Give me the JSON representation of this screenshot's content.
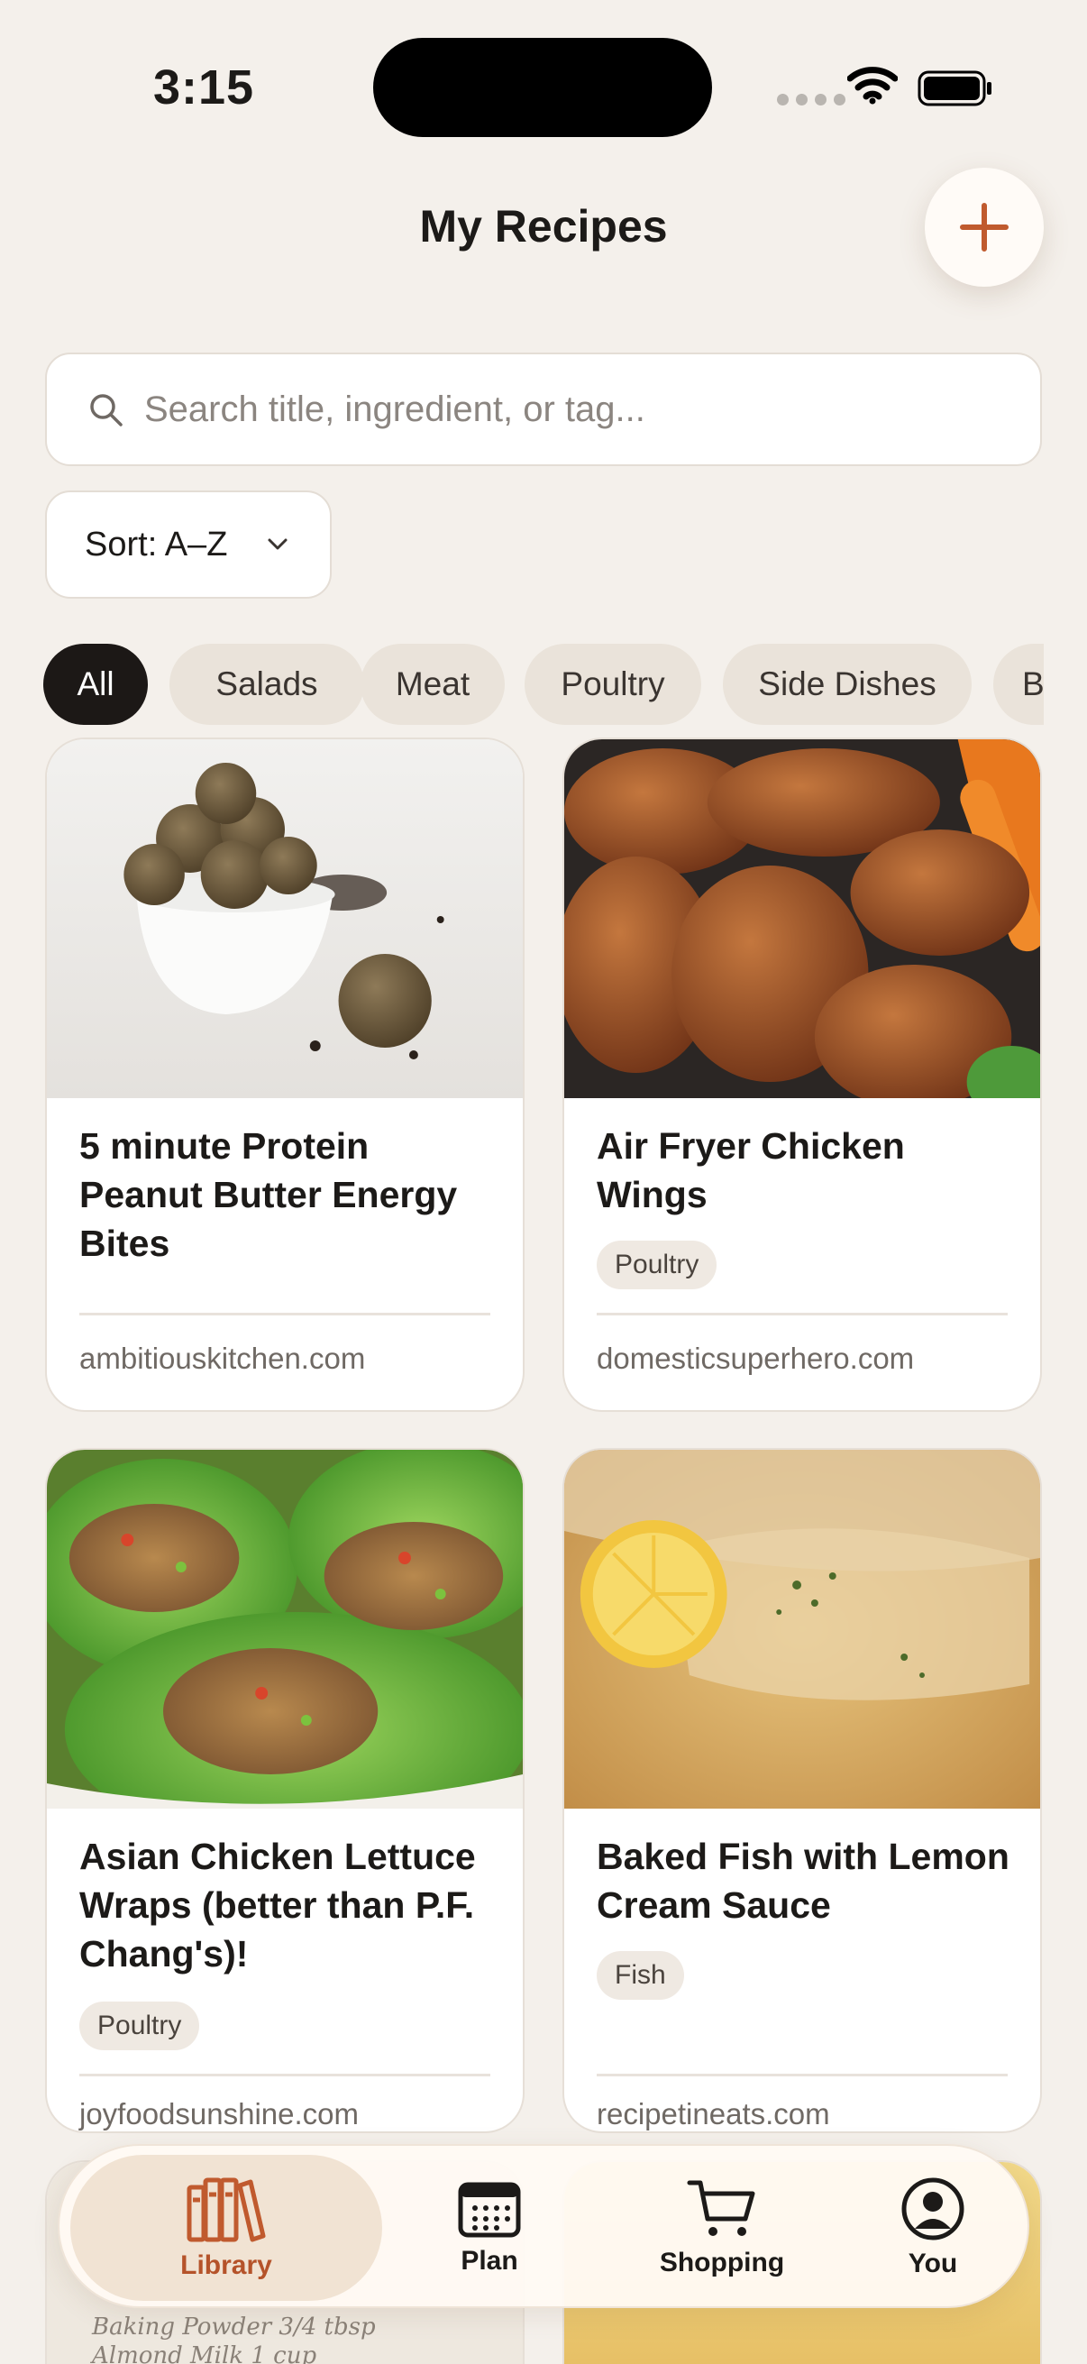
{
  "status_bar": {
    "time": "3:15"
  },
  "header": {
    "title": "My Recipes",
    "add_icon": "plus-icon"
  },
  "search": {
    "placeholder": "Search title, ingredient, or tag...",
    "value": ""
  },
  "sort": {
    "label": "Sort: A–Z"
  },
  "filters": [
    "All",
    "Salads",
    "Meat",
    "Poultry",
    "Side Dishes",
    "B"
  ],
  "active_filter": "All",
  "recipes": [
    {
      "title": "5 minute Protein Peanut Butter Energy Bites",
      "tag": "",
      "source": "ambitiouskitchen.com"
    },
    {
      "title": "Air Fryer Chicken Wings",
      "tag": "Poultry",
      "source": "domesticsuperhero.com"
    },
    {
      "title": "Asian Chicken Lettuce Wraps (better than P.F. Chang's)!",
      "tag": "Poultry",
      "source": "joyfoodsunshine.com"
    },
    {
      "title": "Baked Fish with Lemon Cream Sauce",
      "tag": "Fish",
      "source": "recipetineats.com"
    }
  ],
  "partial_card_text": {
    "line1": "Baking Powder  3/4 tbsp",
    "line2": "Almond Milk  1 cup"
  },
  "nav": {
    "items": [
      {
        "label": "Library",
        "icon": "books-icon"
      },
      {
        "label": "Plan",
        "icon": "calendar-icon"
      },
      {
        "label": "Shopping",
        "icon": "cart-icon"
      },
      {
        "label": "You",
        "icon": "profile-icon"
      }
    ]
  },
  "colors": {
    "accent": "#C05A2E",
    "background": "#F4F0EB",
    "chip_active": "#1C1816"
  }
}
